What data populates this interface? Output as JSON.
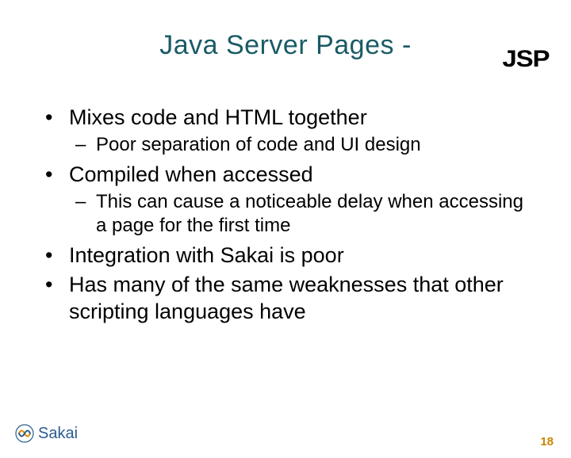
{
  "title": "Java Server Pages -",
  "jsp_logo_text": "JSP",
  "bullets": [
    {
      "text": "Mixes code and HTML together",
      "sub": [
        {
          "text": "Poor separation of code and UI design"
        }
      ]
    },
    {
      "text": "Compiled when accessed",
      "sub": [
        {
          "text": "This can cause a noticeable delay when accessing a page for the first time"
        }
      ]
    },
    {
      "text": "Integration with Sakai is poor",
      "sub": []
    },
    {
      "text": "Has many of the same weaknesses that other scripting languages have",
      "sub": []
    }
  ],
  "sakai_label": "Sakai",
  "page_number": "18"
}
